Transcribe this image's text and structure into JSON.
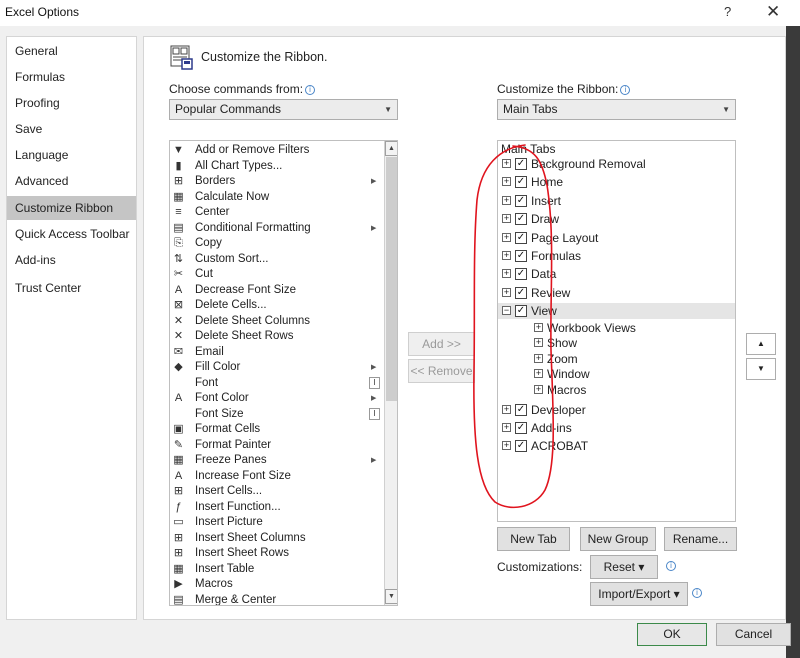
{
  "window": {
    "title": "Excel Options",
    "help": "?",
    "close": "✕"
  },
  "nav": {
    "items": [
      {
        "label": "General"
      },
      {
        "label": "Formulas"
      },
      {
        "label": "Proofing"
      },
      {
        "label": "Save"
      },
      {
        "label": "Language"
      },
      {
        "label": "Advanced"
      },
      {
        "label": "Customize Ribbon"
      },
      {
        "label": "Quick Access Toolbar"
      },
      {
        "label": "Add-ins"
      },
      {
        "label": "Trust Center"
      }
    ],
    "selected": "Customize Ribbon"
  },
  "page": {
    "title": "Customize the Ribbon."
  },
  "left": {
    "choose_label": "Choose commands from:",
    "choose_value": "Popular Commands",
    "commands": [
      {
        "icon": "filter-icon",
        "glyph": "▼",
        "label": "Add or Remove Filters"
      },
      {
        "icon": "chart-icon",
        "glyph": "▮",
        "label": "All Chart Types..."
      },
      {
        "icon": "borders-icon",
        "glyph": "⊞",
        "label": "Borders",
        "extra": "submenu"
      },
      {
        "icon": "calculator-icon",
        "glyph": "▦",
        "label": "Calculate Now"
      },
      {
        "icon": "center-icon",
        "glyph": "≡",
        "label": "Center"
      },
      {
        "icon": "conditional-formatting-icon",
        "glyph": "▤",
        "label": "Conditional Formatting",
        "extra": "submenu"
      },
      {
        "icon": "copy-icon",
        "glyph": "⎘",
        "label": "Copy"
      },
      {
        "icon": "sort-icon",
        "glyph": "⇅",
        "label": "Custom Sort..."
      },
      {
        "icon": "cut-icon",
        "glyph": "✂",
        "label": "Cut"
      },
      {
        "icon": "decrease-font-icon",
        "glyph": "A",
        "label": "Decrease Font Size"
      },
      {
        "icon": "delete-cells-icon",
        "glyph": "⊠",
        "label": "Delete Cells..."
      },
      {
        "icon": "delete-columns-icon",
        "glyph": "✕",
        "label": "Delete Sheet Columns"
      },
      {
        "icon": "delete-rows-icon",
        "glyph": "✕",
        "label": "Delete Sheet Rows"
      },
      {
        "icon": "email-icon",
        "glyph": "✉",
        "label": "Email"
      },
      {
        "icon": "fill-color-icon",
        "glyph": "◆",
        "label": "Fill Color",
        "extra": "submenu"
      },
      {
        "icon": "font-icon",
        "glyph": "",
        "label": "Font",
        "extra": "ibeam"
      },
      {
        "icon": "font-color-icon",
        "glyph": "A",
        "label": "Font Color",
        "extra": "submenu"
      },
      {
        "icon": "font-size-icon",
        "glyph": "",
        "label": "Font Size",
        "extra": "ibeam"
      },
      {
        "icon": "format-cells-icon",
        "glyph": "▣",
        "label": "Format Cells"
      },
      {
        "icon": "format-painter-icon",
        "glyph": "✎",
        "label": "Format Painter"
      },
      {
        "icon": "freeze-panes-icon",
        "glyph": "▦",
        "label": "Freeze Panes",
        "extra": "submenu"
      },
      {
        "icon": "increase-font-icon",
        "glyph": "A",
        "label": "Increase Font Size"
      },
      {
        "icon": "insert-cells-icon",
        "glyph": "⊞",
        "label": "Insert Cells..."
      },
      {
        "icon": "insert-function-icon",
        "glyph": "ƒ",
        "label": "Insert Function..."
      },
      {
        "icon": "insert-picture-icon",
        "glyph": "▭",
        "label": "Insert Picture"
      },
      {
        "icon": "insert-columns-icon",
        "glyph": "⊞",
        "label": "Insert Sheet Columns"
      },
      {
        "icon": "insert-rows-icon",
        "glyph": "⊞",
        "label": "Insert Sheet Rows"
      },
      {
        "icon": "insert-table-icon",
        "glyph": "▦",
        "label": "Insert Table"
      },
      {
        "icon": "macros-icon",
        "glyph": "▶",
        "label": "Macros"
      },
      {
        "icon": "merge-center-icon",
        "glyph": "▤",
        "label": "Merge & Center"
      }
    ]
  },
  "middle": {
    "add_label": "Add >>",
    "remove_label": "<< Remove"
  },
  "right": {
    "customize_label": "Customize the Ribbon:",
    "customize_value": "Main Tabs",
    "header": "Main Tabs",
    "tabs": [
      {
        "label": "Background Removal",
        "expander": "+",
        "checked": true
      },
      {
        "label": "Home",
        "expander": "+",
        "checked": true
      },
      {
        "label": "Insert",
        "expander": "+",
        "checked": true
      },
      {
        "label": "Draw",
        "expander": "+",
        "checked": true
      },
      {
        "label": "Page Layout",
        "expander": "+",
        "checked": true
      },
      {
        "label": "Formulas",
        "expander": "+",
        "checked": true
      },
      {
        "label": "Data",
        "expander": "+",
        "checked": true
      },
      {
        "label": "Review",
        "expander": "+",
        "checked": true
      },
      {
        "label": "View",
        "expander": "−",
        "checked": true,
        "selected": true
      },
      {
        "label": "Developer",
        "expander": "+",
        "checked": true
      },
      {
        "label": "Add-ins",
        "expander": "+",
        "checked": true
      },
      {
        "label": "ACROBAT",
        "expander": "+",
        "checked": true
      }
    ],
    "view_groups": [
      {
        "label": "Workbook Views"
      },
      {
        "label": "Show"
      },
      {
        "label": "Zoom"
      },
      {
        "label": "Window"
      },
      {
        "label": "Macros"
      }
    ],
    "new_tab_label": "New Tab",
    "new_group_label": "New Group",
    "rename_label": "Rename...",
    "customizations_label": "Customizations:",
    "reset_label": "Reset ▾",
    "import_export_label": "Import/Export ▾",
    "move_up": "▲",
    "move_down": "▼"
  },
  "footer": {
    "ok_label": "OK",
    "cancel_label": "Cancel"
  },
  "colors": {
    "selected_nav": "#c5c5c5",
    "annotation": "#e0141e",
    "ok_border": "#3c8a4a"
  }
}
